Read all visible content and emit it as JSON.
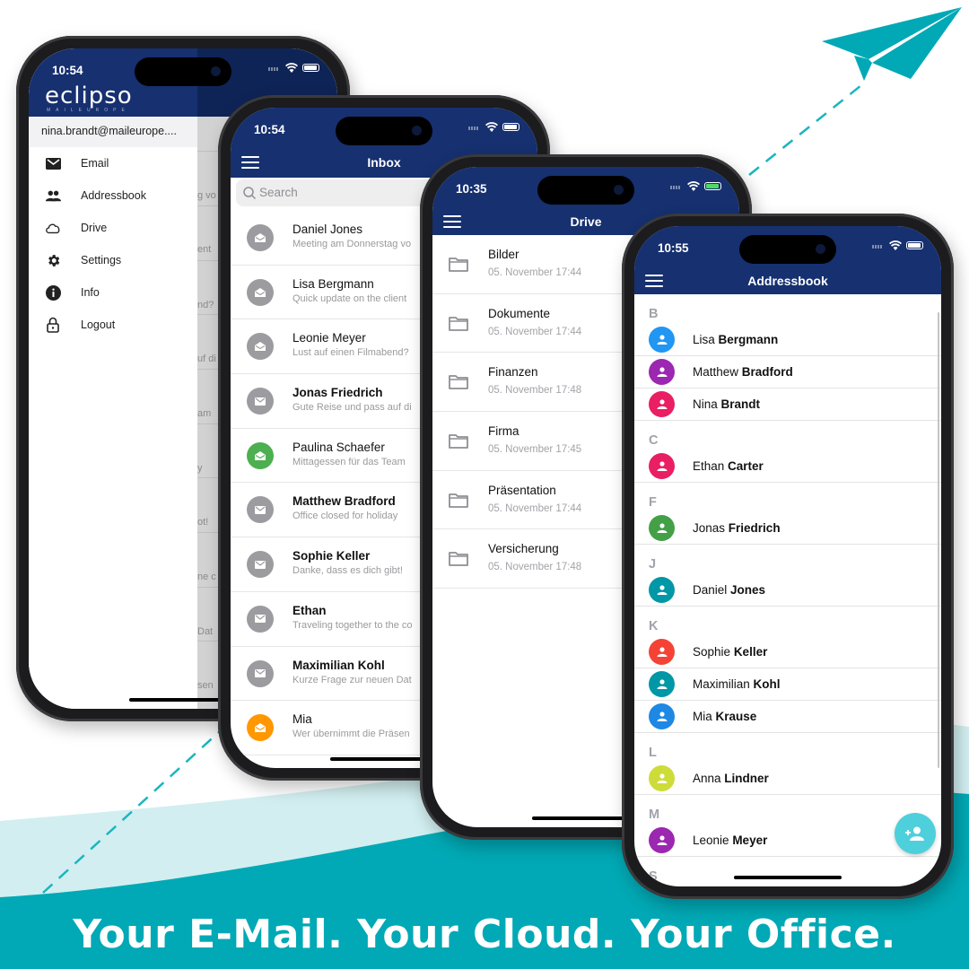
{
  "tagline": "Your E-Mail. Your Cloud. Your Office.",
  "colors": {
    "brand_navy": "#163070",
    "teal": "#00a9b5",
    "light_teal": "#d2eef0"
  },
  "drawer_screen": {
    "time": "10:54",
    "logo": "eclipso",
    "logo_sub": "MAILEUROPE",
    "account": "nina.brandt@maileurope....",
    "items": [
      {
        "label": "Email",
        "icon": "envelope-icon"
      },
      {
        "label": "Addressbook",
        "icon": "people-icon"
      },
      {
        "label": "Drive",
        "icon": "cloud-icon"
      },
      {
        "label": "Settings",
        "icon": "gear-icon"
      },
      {
        "label": "Info",
        "icon": "info-icon"
      },
      {
        "label": "Logout",
        "icon": "lock-icon"
      }
    ],
    "background_fragments": [
      "g vo",
      "ent",
      "nd?",
      "uf di",
      "am",
      "y",
      "ot!",
      "ne c",
      "Dat",
      "sen"
    ]
  },
  "inbox_screen": {
    "time": "10:54",
    "title": "Inbox",
    "search_placeholder": "Search",
    "messages": [
      {
        "sender": "Daniel Jones",
        "preview": "Meeting am Donnerstag vo",
        "unread": false,
        "avatar_color": "#9b9ba0"
      },
      {
        "sender": "Lisa Bergmann",
        "preview": "Quick update on the client",
        "unread": false,
        "avatar_color": "#9b9ba0"
      },
      {
        "sender": "Leonie Meyer",
        "preview": "Lust auf einen Filmabend?",
        "unread": false,
        "avatar_color": "#9b9ba0"
      },
      {
        "sender": "Jonas Friedrich",
        "preview": "Gute Reise und pass auf di",
        "unread": true,
        "avatar_color": "#9b9ba0"
      },
      {
        "sender": "Paulina Schaefer",
        "preview": "Mittagessen für das Team",
        "unread": false,
        "avatar_color": "#4caf50"
      },
      {
        "sender": "Matthew Bradford",
        "preview": "Office closed for holiday",
        "unread": true,
        "avatar_color": "#9b9ba0"
      },
      {
        "sender": "Sophie Keller",
        "preview": "Danke, dass es dich gibt!",
        "unread": true,
        "avatar_color": "#9b9ba0"
      },
      {
        "sender": "Ethan",
        "preview": "Traveling together to the co",
        "unread": true,
        "avatar_color": "#9b9ba0"
      },
      {
        "sender": "Maximilian Kohl",
        "preview": "Kurze Frage zur neuen Dat",
        "unread": true,
        "avatar_color": "#9b9ba0"
      },
      {
        "sender": "Mia",
        "preview": "Wer übernimmt die Präsen",
        "unread": false,
        "avatar_color": "#ff9800"
      }
    ]
  },
  "drive_screen": {
    "time": "10:35",
    "title": "Drive",
    "folders": [
      {
        "name": "Bilder",
        "date": "05. November 17:44"
      },
      {
        "name": "Dokumente",
        "date": "05. November 17:44"
      },
      {
        "name": "Finanzen",
        "date": "05. November 17:48"
      },
      {
        "name": "Firma",
        "date": "05. November 17:45"
      },
      {
        "name": "Präsentation",
        "date": "05. November 17:44"
      },
      {
        "name": "Versicherung",
        "date": "05. November 17:48"
      }
    ]
  },
  "addressbook_screen": {
    "time": "10:55",
    "title": "Addressbook",
    "sections": [
      {
        "letter": "B",
        "contacts": [
          {
            "first": "Lisa",
            "last": "Bergmann",
            "color": "#2196f3"
          },
          {
            "first": "Matthew",
            "last": "Bradford",
            "color": "#9c27b0"
          },
          {
            "first": "Nina",
            "last": "Brandt",
            "color": "#e91e63"
          }
        ]
      },
      {
        "letter": "C",
        "contacts": [
          {
            "first": "Ethan",
            "last": "Carter",
            "color": "#e91e63"
          }
        ]
      },
      {
        "letter": "F",
        "contacts": [
          {
            "first": "Jonas",
            "last": "Friedrich",
            "color": "#43a047"
          }
        ]
      },
      {
        "letter": "J",
        "contacts": [
          {
            "first": "Daniel",
            "last": "Jones",
            "color": "#0097a7"
          }
        ]
      },
      {
        "letter": "K",
        "contacts": [
          {
            "first": "Sophie",
            "last": "Keller",
            "color": "#f44336"
          },
          {
            "first": "Maximilian",
            "last": "Kohl",
            "color": "#0097a7"
          },
          {
            "first": "Mia",
            "last": "Krause",
            "color": "#1e88e5"
          }
        ]
      },
      {
        "letter": "L",
        "contacts": [
          {
            "first": "Anna",
            "last": "Lindner",
            "color": "#cddc39"
          }
        ]
      },
      {
        "letter": "M",
        "contacts": [
          {
            "first": "Leonie",
            "last": "Meyer",
            "color": "#9c27b0"
          }
        ]
      },
      {
        "letter": "S",
        "contacts": []
      }
    ],
    "fab_icon": "add-person-icon"
  }
}
